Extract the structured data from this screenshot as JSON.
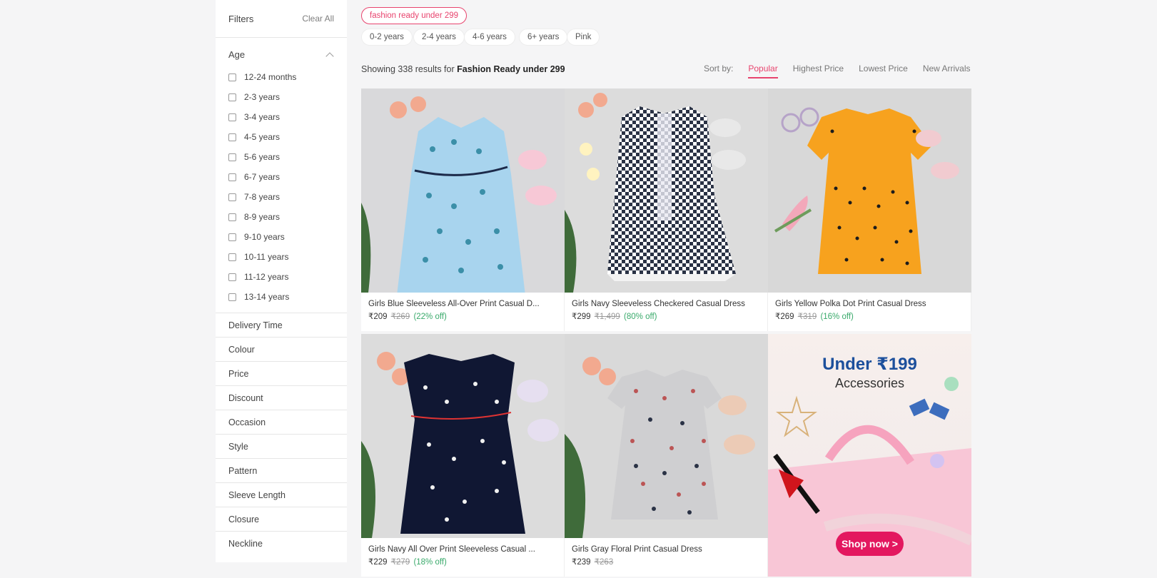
{
  "sidebar": {
    "title": "Filters",
    "clear": "Clear All",
    "age": {
      "label": "Age",
      "options": [
        "12-24 months",
        "2-3 years",
        "3-4 years",
        "4-5 years",
        "5-6 years",
        "6-7 years",
        "7-8 years",
        "8-9 years",
        "9-10 years",
        "10-11 years",
        "11-12 years",
        "13-14 years"
      ]
    },
    "facets": [
      "Delivery Time",
      "Colour",
      "Price",
      "Discount",
      "Occasion",
      "Style",
      "Pattern",
      "Sleeve Length",
      "Closure",
      "Neckline"
    ]
  },
  "chips": {
    "active": "fashion ready under 299",
    "others": [
      "0-2 years",
      "2-4 years",
      "4-6 years",
      "6+ years",
      "Pink"
    ]
  },
  "results": {
    "prefix": "Showing 338 results for ",
    "query": "Fashion Ready under 299"
  },
  "sort": {
    "label": "Sort by:",
    "options": [
      "Popular",
      "Highest Price",
      "Lowest Price",
      "New Arrivals"
    ]
  },
  "products": [
    {
      "name": "Girls Blue Sleeveless All-Over Print Casual D...",
      "price": "₹209",
      "mrp": "₹269",
      "off": "(22% off)"
    },
    {
      "name": "Girls Navy Sleeveless Checkered Casual Dress",
      "price": "₹299",
      "mrp": "₹1,499",
      "off": "(80% off)"
    },
    {
      "name": "Girls Yellow Polka Dot Print Casual Dress",
      "price": "₹269",
      "mrp": "₹319",
      "off": "(16% off)"
    },
    {
      "name": "Girls Navy All Over Print Sleeveless Casual ...",
      "price": "₹229",
      "mrp": "₹279",
      "off": "(18% off)"
    },
    {
      "name": "Girls Gray Floral Print Casual Dress",
      "price": "₹239",
      "mrp": "₹263",
      "off": ""
    }
  ],
  "banner": {
    "title": "Under ₹199",
    "subtitle": "Accessories",
    "button": "Shop now >"
  },
  "colors": {
    "accent": "#e8446e",
    "discount": "#3aaa6b",
    "banner_title": "#1c4f9c",
    "banner_button": "#e3175f"
  }
}
